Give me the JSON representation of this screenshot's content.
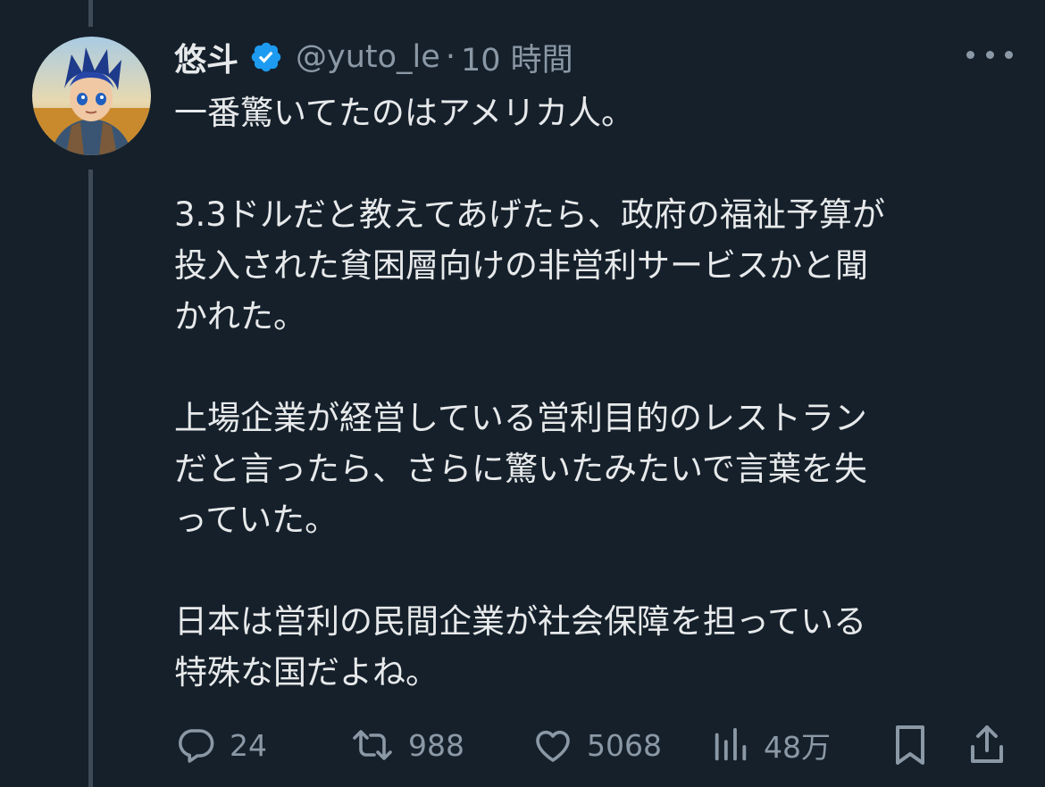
{
  "author": {
    "name": "悠斗",
    "handle": "@yuto_le",
    "separator": "·",
    "time": "10 時間",
    "verified": true,
    "verified_color": "#1d9bf0"
  },
  "tweet": {
    "paragraphs": [
      "一番驚いてたのはアメリカ人。",
      "3.3ドルだと教えてあげたら、政府の福祉予算が\n投入された貧困層向けの非営利サービスかと聞\nかれた。",
      "上場企業が経営している営利目的のレストラン\nだと言ったら、さらに驚いたみたいで言葉を失\nっていた。",
      "日本は営利の民間企業が社会保障を担っている\n特殊な国だよね。"
    ]
  },
  "actions": {
    "reply": {
      "icon": "reply-icon",
      "count": "24"
    },
    "retweet": {
      "icon": "retweet-icon",
      "count": "988"
    },
    "like": {
      "icon": "heart-icon",
      "count": "5068"
    },
    "views": {
      "icon": "views-icon",
      "count": "48万"
    },
    "bookmark": {
      "icon": "bookmark-icon"
    },
    "share": {
      "icon": "share-icon"
    }
  },
  "colors": {
    "background": "#15202b",
    "text": "#e7e9ea",
    "muted": "#8b98a5",
    "thread_line": "#3e4a55"
  }
}
